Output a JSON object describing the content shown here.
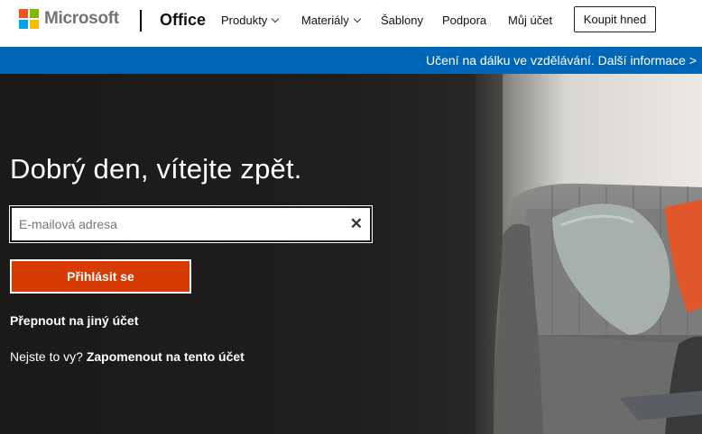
{
  "brand": {
    "logo_text": "Microsoft",
    "product": "Office",
    "logo_colors": [
      "#f25022",
      "#7fba00",
      "#00a4ef",
      "#ffb900"
    ]
  },
  "nav": {
    "items": [
      {
        "label": "Produkty"
      },
      {
        "label": "Materiály"
      },
      {
        "label": "Šablony"
      },
      {
        "label": "Podpora"
      },
      {
        "label": "Můj účet"
      }
    ],
    "buy_label": "Koupit hned"
  },
  "banner": {
    "text": "Učení na dálku ve vzdělávání. Další informace >",
    "color": "#0067b8"
  },
  "login": {
    "headline": "Dobrý den, vítejte zpět.",
    "email_placeholder": "E-mailová adresa",
    "signin_label": "Přihlásit se",
    "switch_label": "Přepnout na jiný účet",
    "not_you": "Nejste to vy?",
    "forget_label": "Zapomenout na tento účet",
    "accent": "#d83b01"
  }
}
